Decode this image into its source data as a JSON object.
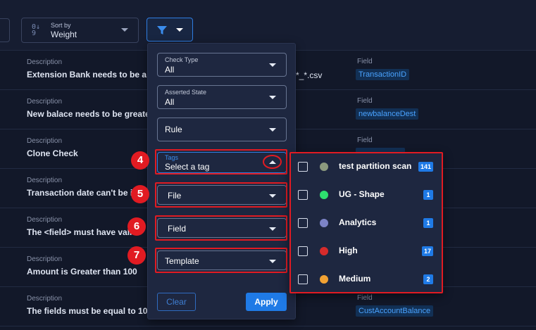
{
  "toolbar": {
    "sort_caption": "Sort by",
    "sort_value": "Weight"
  },
  "rows": [
    {
      "desc_label": "Description",
      "desc": "Extension Bank needs to be a rep",
      "field_label": "Field",
      "field": "TransactionID"
    },
    {
      "desc_label": "Description",
      "desc": "New balace needs to be greater",
      "field_label": "Field",
      "field": "newbalanceDest"
    },
    {
      "desc_label": "Description",
      "desc": "Clone Check",
      "field_label": "Field",
      "field": ""
    },
    {
      "desc_label": "Description",
      "desc": "Transaction date can't be in",
      "field_label": "",
      "field": ""
    },
    {
      "desc_label": "Description",
      "desc": "The <field> must have valid",
      "field_label": "",
      "field": ""
    },
    {
      "desc_label": "Description",
      "desc": "Amount is Greater than 100",
      "field_label": "",
      "field": ""
    },
    {
      "desc_label": "Description",
      "desc": "The fields must be equal to 1000",
      "field_label": "Field",
      "field": "CustAccountBalance"
    }
  ],
  "row1_extra": "*_*.csv",
  "filter_panel": {
    "check_type": {
      "caption": "Check Type",
      "value": "All"
    },
    "asserted_state": {
      "caption": "Asserted State",
      "value": "All"
    },
    "rule": {
      "value": "Rule"
    },
    "tags": {
      "caption": "Tags",
      "placeholder": "Select a tag"
    },
    "file": {
      "value": "File"
    },
    "field": {
      "value": "Field"
    },
    "template": {
      "value": "Template"
    },
    "clear_label": "Clear",
    "apply_label": "Apply"
  },
  "annotations": {
    "step4": "4",
    "step5": "5",
    "step6": "6",
    "step7": "7"
  },
  "tags_dropdown": [
    {
      "name": "test partition scan",
      "count": "141",
      "color": "#8c9a7e"
    },
    {
      "name": "UG - Shape",
      "count": "1",
      "color": "#2ee06f"
    },
    {
      "name": "Analytics",
      "count": "1",
      "color": "#7c83c6"
    },
    {
      "name": "High",
      "count": "17",
      "color": "#d62b2b"
    },
    {
      "name": "Medium",
      "count": "2",
      "color": "#f2a233"
    }
  ],
  "colors": {
    "accent": "#1f7ae6",
    "highlight": "#e11b22",
    "background": "#121829"
  },
  "icons": {
    "sort": "sort-numeric-icon",
    "filter": "filter-funnel-icon"
  }
}
